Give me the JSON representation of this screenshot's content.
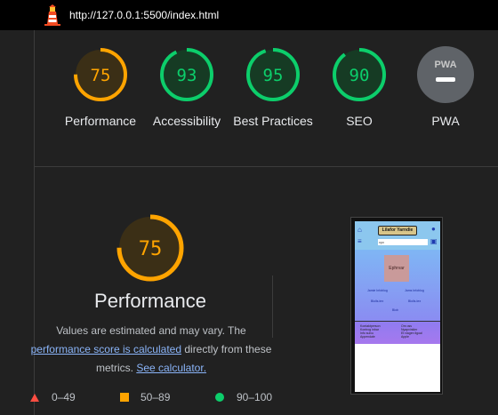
{
  "browser": {
    "url": "http://127.0.0.1:5500/index.html"
  },
  "colors": {
    "pass": "#0cce6b",
    "average": "#ffa400",
    "fail": "#ff4e42",
    "pwa": "#5f6368"
  },
  "categories": [
    {
      "label": "Performance",
      "score": "75",
      "status": "average"
    },
    {
      "label": "Accessibility",
      "score": "93",
      "status": "pass"
    },
    {
      "label": "Best Practices",
      "score": "95",
      "status": "pass"
    },
    {
      "label": "SEO",
      "score": "90",
      "status": "pass"
    },
    {
      "label": "PWA",
      "score": "",
      "status": "pwa",
      "badge": "PWA"
    }
  ],
  "performance": {
    "score": "75",
    "title": "Performance",
    "desc_1": "Values are estimated and may vary. The",
    "desc_link_1": "performance score is calculated",
    "desc_2": " directly from these metrics. ",
    "desc_link_2": "See calculator."
  },
  "legend": {
    "fail": "0–49",
    "average": "50–89",
    "pass": "90–100"
  },
  "thumbnail": {
    "logo": "Lilafor Yarndie",
    "search": "vyv",
    "image_text": "Ephrvar",
    "links": [
      "Jamie Infoblog",
      "Jams Infoblog",
      "Blolls-tex",
      "Blolls-tex",
      "Blob"
    ],
    "footer_left": [
      "Kontaktperson",
      "Kontrog inbar",
      "Info suivu",
      "Appendale"
    ],
    "footer_right": [
      "Om oss",
      "Nyapvinkler",
      "Et viagen ligoal",
      "Apple"
    ]
  }
}
